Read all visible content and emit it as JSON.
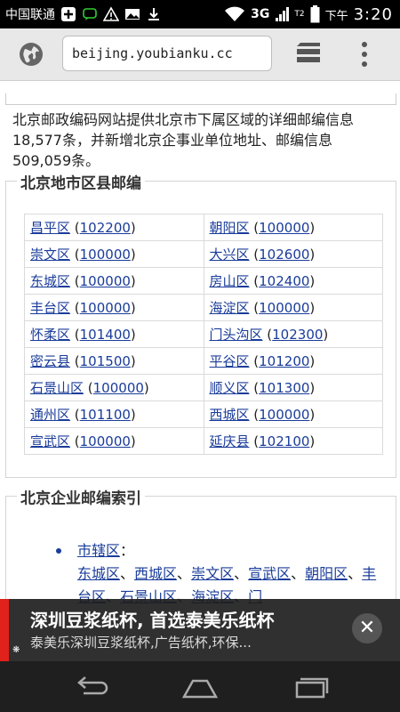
{
  "status": {
    "carrier": "中国联通",
    "network": "3G",
    "network_sub": "T2",
    "time_prefix": "下午",
    "time": "3:20"
  },
  "browser": {
    "url": "beijing.youbianku.cc",
    "icons": {
      "site": "globe-icon",
      "tabs": "tabs-icon",
      "menu": "overflow-menu-icon"
    }
  },
  "page": {
    "intro": "北京邮政编码网站提供北京市下属区域的详细邮编信息18,577条，并新增北京企事业单位地址、邮编信息509,059条。",
    "district_title": "北京地市区县邮编",
    "districts": [
      {
        "name": "昌平区",
        "code": "102200"
      },
      {
        "name": "朝阳区",
        "code": "100000"
      },
      {
        "name": "崇文区",
        "code": "100000"
      },
      {
        "name": "大兴区",
        "code": "102600"
      },
      {
        "name": "东城区",
        "code": "100000"
      },
      {
        "name": "房山区",
        "code": "102400"
      },
      {
        "name": "丰台区",
        "code": "100000"
      },
      {
        "name": "海淀区",
        "code": "100000"
      },
      {
        "name": "怀柔区",
        "code": "101400"
      },
      {
        "name": "门头沟区",
        "code": "102300"
      },
      {
        "name": "密云县",
        "code": "101500"
      },
      {
        "name": "平谷区",
        "code": "101200"
      },
      {
        "name": "石景山区",
        "code": "100000"
      },
      {
        "name": "顺义区",
        "code": "101300"
      },
      {
        "name": "通州区",
        "code": "101100"
      },
      {
        "name": "西城区",
        "code": "100000"
      },
      {
        "name": "宣武区",
        "code": "100000"
      },
      {
        "name": "延庆县",
        "code": "102100"
      }
    ],
    "index_title": "北京企业邮编索引",
    "index_item_label": "市辖区",
    "index_item_colon": "：",
    "index_sublinks": [
      "东城区",
      "西城区",
      "崇文区",
      "宣武区",
      "朝阳区",
      "丰台区",
      "石景山区",
      "海淀区",
      "门"
    ]
  },
  "ad": {
    "title": "深圳豆浆纸杯, 首选泰美乐纸杯",
    "subtitle": "泰美乐深圳豆浆纸杯,广告纸杯,环保...",
    "close": "✕",
    "accent": "#e0211c"
  }
}
